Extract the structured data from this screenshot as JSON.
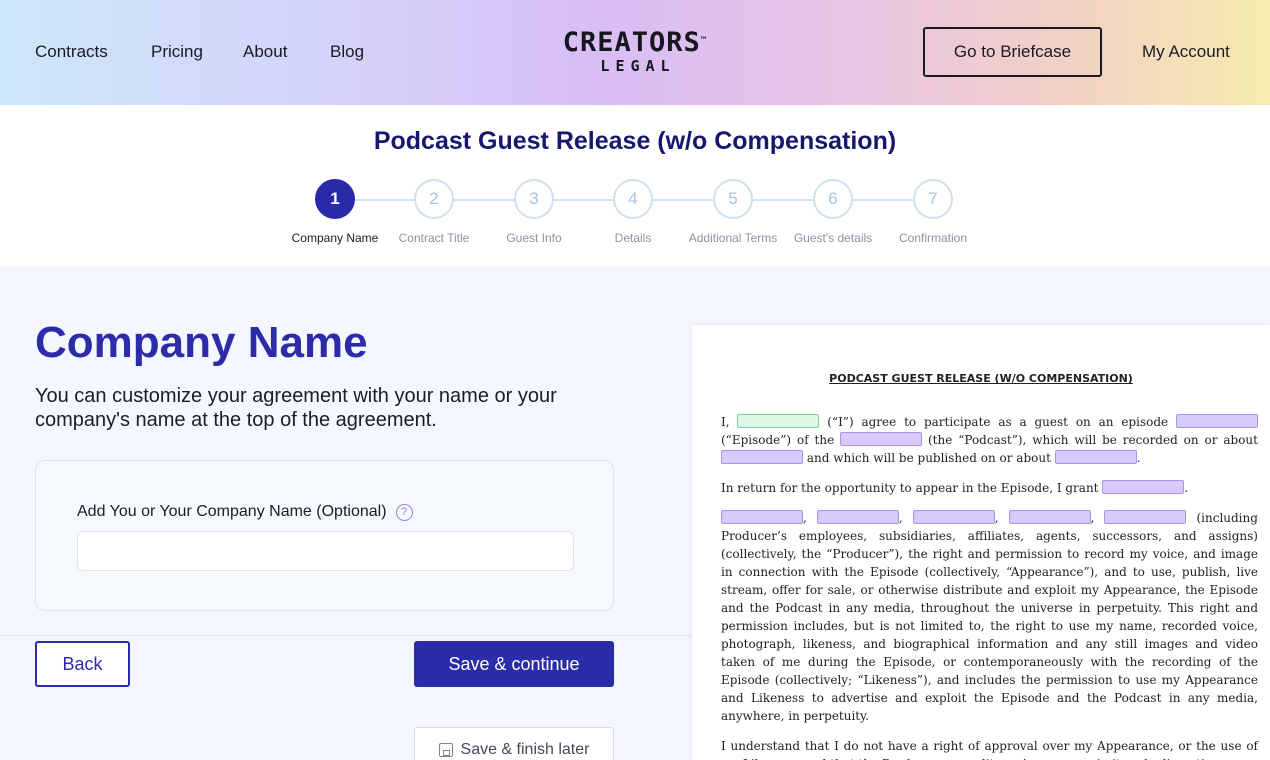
{
  "header": {
    "nav": [
      "Contracts",
      "Pricing",
      "About",
      "Blog"
    ],
    "logo_main": "CREATORS",
    "logo_tm": "™",
    "logo_sub": "LEGAL",
    "briefcase_label": "Go to Briefcase",
    "account_label": "My Account"
  },
  "page_title": "Podcast Guest Release (w/o Compensation)",
  "stepper": {
    "active": 1,
    "steps": [
      {
        "num": "1",
        "label": "Company Name"
      },
      {
        "num": "2",
        "label": "Contract Title"
      },
      {
        "num": "3",
        "label": "Guest Info"
      },
      {
        "num": "4",
        "label": "Details"
      },
      {
        "num": "5",
        "label": "Additional Terms"
      },
      {
        "num": "6",
        "label": "Guest's details"
      },
      {
        "num": "7",
        "label": "Confirmation"
      }
    ]
  },
  "form": {
    "section_title": "Company Name",
    "description": "You can customize your agreement with your name or your company's name at the top of the agreement.",
    "field_label": "Add You or Your Company Name (Optional)",
    "help_icon_text": "?",
    "field_value": "",
    "field_placeholder": ""
  },
  "buttons": {
    "back": "Back",
    "save_continue": "Save & continue",
    "save_later": "Save & finish later"
  },
  "document": {
    "title": "PODCAST GUEST RELEASE (W/O COMPENSATION)",
    "p1_a": "I,",
    "p1_b": "(“I”) agree to participate as a guest on an episode",
    "p1_c": "(“Episode”) of the",
    "p1_d": "(the “Podcast”), which will be recorded on or about",
    "p1_e": "and which will be published on or about",
    "p1_f": ".",
    "p2_a": "In return for the opportunity to appear in the Episode, I grant",
    "p2_b": ".",
    "p3_sep": ",",
    "p3_text": "(including Producer’s employees, subsidiaries, affiliates, agents, successors, and assigns) (collectively, the “Producer”), the right and permission to record my voice, and image in connection with the Episode (collectively, “Appearance”), and to use, publish, live stream, offer for sale, or otherwise distribute and exploit my Appearance, the Episode and the Podcast in any media, throughout the universe in perpetuity. This right and permission includes, but is not limited to, the right to use my name, recorded voice, photograph, likeness, and biographical information and any still images and video taken of me during the Episode, or contemporaneously with the recording of the Episode (collectively; “Likeness”), and includes the permission to use my Appearance and Likeness to advertise and exploit the Episode and the Podcast in any media, anywhere, in perpetuity.",
    "p4": "I understand that I do not have a right of approval over my Appearance, or the use of my Likeness, and that the Producer may edit my Appearance in its sole discretion."
  },
  "colors": {
    "primary": "#2b2ca7",
    "title": "#17176e",
    "blank_field": "#d6cbfb",
    "filled_field": "#d9f7e3"
  }
}
